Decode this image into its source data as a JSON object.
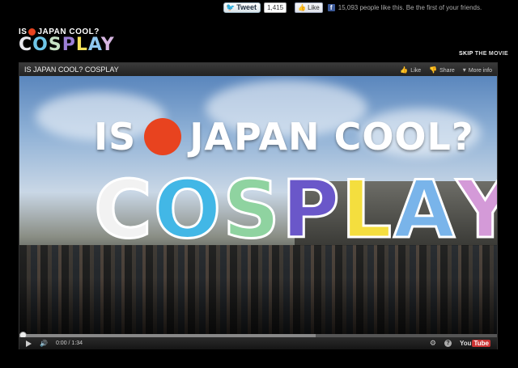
{
  "social": {
    "tweet_label": "Tweet",
    "tweet_count": "1,415",
    "like_label": "Like",
    "fb_text": "15,093 people like this. Be the first of your friends."
  },
  "logo": {
    "line1_left": "IS",
    "line1_right": "JAPAN COOL?",
    "line2_letters": [
      "C",
      "O",
      "S",
      "P",
      "L",
      "A",
      "Y"
    ]
  },
  "skip": {
    "bold": "SKIP",
    "rest": " THE MOVIE"
  },
  "player": {
    "title": "IS JAPAN COOL? COSPLAY",
    "actions": {
      "like": "Like",
      "share": "Share",
      "more": "More info"
    },
    "video": {
      "headline_left": "IS",
      "headline_right": "JAPAN COOL?",
      "cosplay_letters": [
        "C",
        "O",
        "S",
        "P",
        "L",
        "A",
        "Y"
      ]
    },
    "controls": {
      "time": "0:00 / 1:34",
      "progress_fraction": 0,
      "buffer_fraction": 0.62,
      "youtube_you": "You",
      "youtube_tube": "Tube"
    }
  },
  "colors": {
    "accent_red": "#e8431f",
    "youtube_red": "#cc3333",
    "facebook_blue": "#3b5998"
  }
}
